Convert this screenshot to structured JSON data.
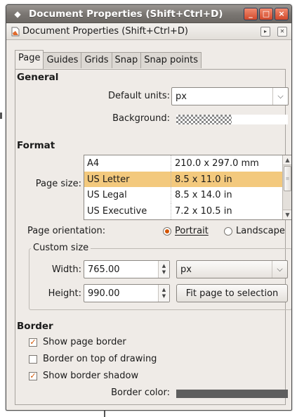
{
  "window": {
    "title": "Document Properties (Shift+Ctrl+D)",
    "minimize_glyph": "_",
    "maximize_glyph": "□",
    "close_glyph": "×"
  },
  "dock": {
    "title": "Document Properties (Shift+Ctrl+D)",
    "float_glyph": "▸",
    "close_glyph": "✕"
  },
  "tabs": [
    {
      "label": "Page",
      "active": true
    },
    {
      "label": "Guides"
    },
    {
      "label": "Grids"
    },
    {
      "label": "Snap"
    },
    {
      "label": "Snap points"
    }
  ],
  "general": {
    "title": "General",
    "units_label": "Default units:",
    "units_value": "px",
    "background_label": "Background:"
  },
  "format": {
    "title": "Format",
    "page_size_label": "Page size:",
    "page_sizes": [
      {
        "name": "A4",
        "size": "210.0 x 297.0 mm"
      },
      {
        "name": "US Letter",
        "size": "8.5 x 11.0 in",
        "selected": true
      },
      {
        "name": "US Legal",
        "size": "8.5 x 14.0 in"
      },
      {
        "name": "US Executive",
        "size": "7.2 x 10.5 in"
      }
    ],
    "orientation_label": "Page orientation:",
    "portrait_label": "Portrait",
    "landscape_label": "Landscape",
    "orientation_value": "Portrait",
    "custom_size_title": "Custom size",
    "width_label": "Width:",
    "width_value": "765.00",
    "height_label": "Height:",
    "height_value": "990.00",
    "units_value": "px",
    "fit_button": "Fit page to selection"
  },
  "border": {
    "title": "Border",
    "show_page_border": {
      "label": "Show page border",
      "checked": true
    },
    "border_on_top": {
      "label": "Border on top of drawing",
      "checked": false
    },
    "show_border_shadow": {
      "label": "Show border shadow",
      "checked": true
    },
    "border_color_label": "Border color:",
    "border_color": "#5e5e5e"
  },
  "colors": {
    "selection": "#f3c97d",
    "accent": "#d35400"
  }
}
